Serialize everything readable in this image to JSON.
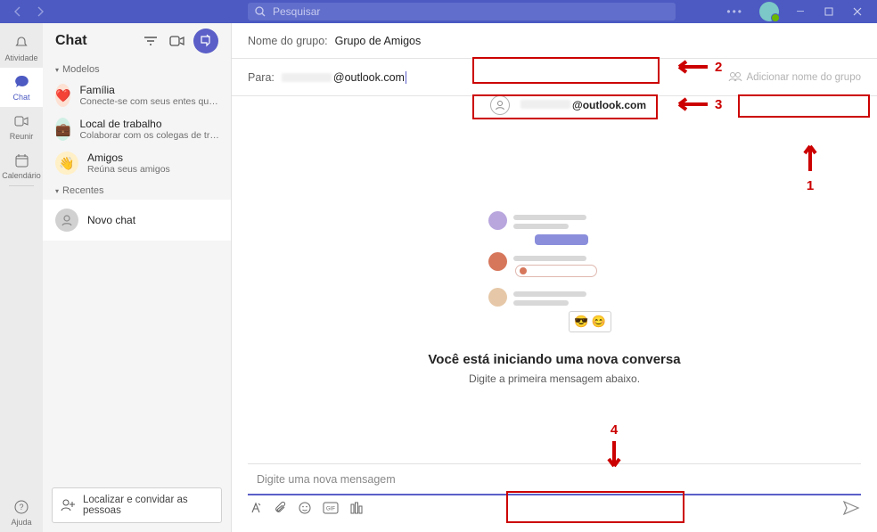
{
  "titlebar": {
    "search_placeholder": "Pesquisar"
  },
  "rail": {
    "activity": "Atividade",
    "chat": "Chat",
    "meet": "Reunir",
    "calendar": "Calendário",
    "help": "Ajuda"
  },
  "panel": {
    "title": "Chat",
    "models": "Modelos",
    "recent": "Recentes",
    "templates": [
      {
        "name": "Família",
        "desc": "Conecte-se com seus entes queridos"
      },
      {
        "name": "Local de trabalho",
        "desc": "Colaborar com os colegas de trabal..."
      },
      {
        "name": "Amigos",
        "desc": "Reúna seus amigos"
      }
    ],
    "new_chat": "Novo chat",
    "invite": "Localizar e convidar as pessoas"
  },
  "compose": {
    "group_label": "Nome do grupo:",
    "group_value": "Grupo de Amigos",
    "to_label": "Para:",
    "to_value": "@outlook.com",
    "add_group": "Adicionar nome do grupo",
    "suggestion": "@outlook.com"
  },
  "placeholder": {
    "title": "Você está iniciando uma nova conversa",
    "subtitle": "Digite a primeira mensagem abaixo."
  },
  "composer": {
    "placeholder": "Digite uma nova mensagem"
  },
  "annotations": {
    "n1": "1",
    "n2": "2",
    "n3": "3",
    "n4": "4"
  }
}
